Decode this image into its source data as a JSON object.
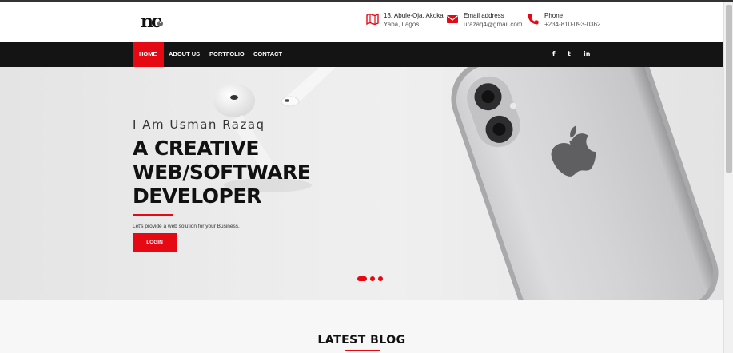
{
  "header": {
    "logo_text": "nc",
    "logo_mark": "•",
    "address": {
      "icon": "map-icon",
      "line1": "13, Abule-Oja, Akoka",
      "line2": "Yaba, Lagos"
    },
    "email": {
      "icon": "envelope-icon",
      "label": "Email address",
      "value": "urazaq4@gmail.com"
    },
    "phone": {
      "icon": "phone-icon",
      "label": "Phone",
      "value": "+234-810-093-0362"
    }
  },
  "nav": {
    "items": [
      {
        "label": "HOME",
        "active": true
      },
      {
        "label": "ABOUT US"
      },
      {
        "label": "PORTFOLIO"
      },
      {
        "label": "CONTACT"
      }
    ],
    "social": [
      {
        "icon": "facebook-icon",
        "glyph": "f"
      },
      {
        "icon": "twitter-icon",
        "glyph": "t"
      },
      {
        "icon": "linkedin-icon",
        "glyph": "in"
      }
    ]
  },
  "hero": {
    "kicker": "I Am Usman Razaq",
    "title_line1": "A CREATIVE",
    "title_line2": "WEB/SOFTWARE",
    "title_line3": "DEVELOPER",
    "subtitle": "Let's provide a web solution for your Business.",
    "button_label": "LOGIN",
    "slides": 3,
    "active_slide": 1
  },
  "blog": {
    "title": "LATEST BLOG"
  },
  "colors": {
    "accent": "#e50914",
    "nav_bg": "#141414"
  }
}
